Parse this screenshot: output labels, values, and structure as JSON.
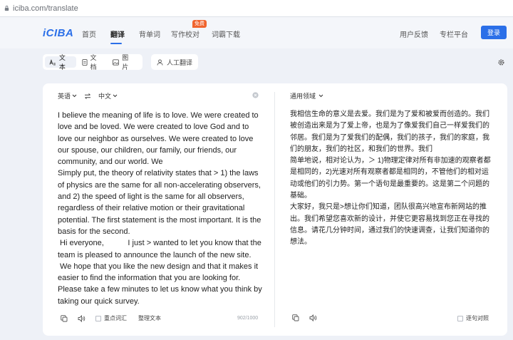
{
  "browser": {
    "url": "iciba.com/translate"
  },
  "header": {
    "logo": "iCIBA",
    "nav": [
      {
        "label": "首页"
      },
      {
        "label": "翻译"
      },
      {
        "label": "背单词"
      },
      {
        "label": "写作校对"
      },
      {
        "label": "词霸下载"
      }
    ],
    "badge": "免费",
    "right_links": [
      {
        "label": "用户反馈"
      },
      {
        "label": "专栏平台"
      }
    ],
    "login_label": "登录",
    "accent_color": "#2b6fe8"
  },
  "modes": {
    "tabs": [
      {
        "label": "文本"
      },
      {
        "label": "文档"
      },
      {
        "label": "图片"
      }
    ],
    "human_translation": "人工翻译"
  },
  "source": {
    "language": "英语",
    "target_language": "中文",
    "text_lines": [
      "I believe the meaning of life is to love. We were created to love and be loved. We were created to love God and to love our neighbor as ourselves. We were created to love our spouse, our children, our family, our friends, our community, and our world. We",
      "Simply put, the theory of relativity states that > 1) the laws of physics are the same for all non-accelerating observers, and 2) the speed of light is the same for all observers, regardless of their relative motion or their gravitational potential. The first statement is the most important. It is the basis for the second.",
      " Hi everyone,           I just > wanted to let you know that the team is pleased to announce the launch of the new site.  We hope that you like the new design and that it makes it easier to find the information that you are looking for. Please take a few minutes to let us know what you think by taking our quick survey."
    ],
    "key_words_label": "重点词汇",
    "organize_label": "整理文本",
    "counter": "902/1000"
  },
  "target": {
    "domain": "通用领域",
    "text_lines": [
      "我相信生命的意义是去爱。我们是为了爱和被爱而创造的。我们被创造出来是为了爱上帝，也是为了像爱我们自己一样爱我们的邻居。我们是为了爱我们的配偶，我们的孩子，我们的家庭，我们的朋友，我们的社区，和我们的世界。我们",
      "简单地说，相对论认为，＞ 1)物理定律对所有非加速的观察者都是相同的，2)光速对所有观察者都是相同的，不管他们的相对运动或他们的引力势。第一个语句是最重要的。这是第二个问题的基础。",
      "大家好，我只是>想让你们知道，团队很高兴地宣布新网站的推出。我们希望您喜欢新的设计，并使它更容易找到您正在寻找的信息。请花几分钟时间，通过我们的快速调查，让我们知道你的想法。"
    ],
    "contrast_label": "逐句对照"
  }
}
